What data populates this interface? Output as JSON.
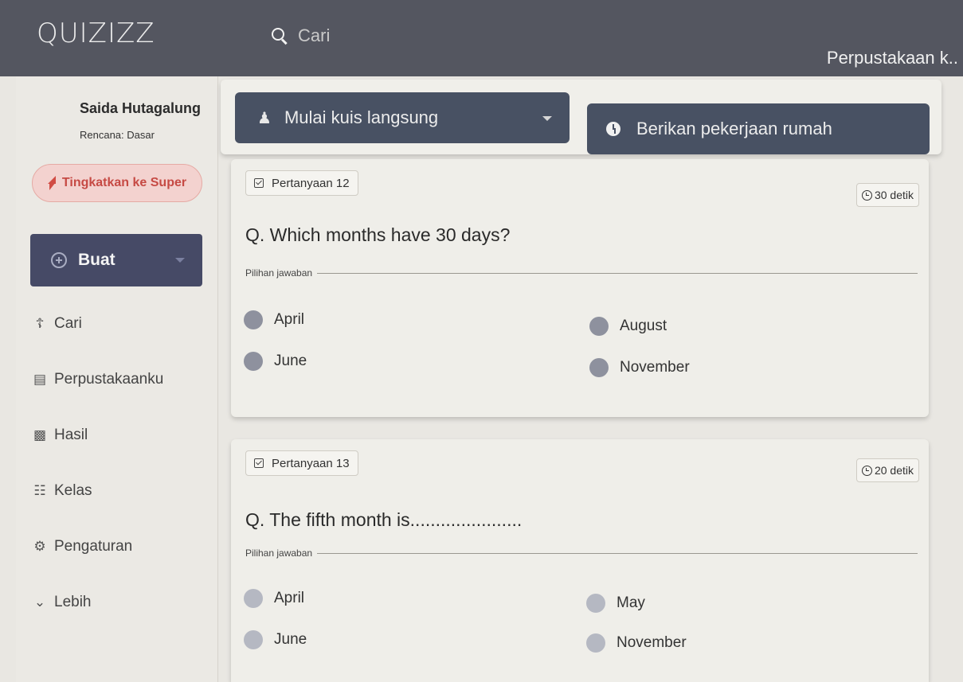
{
  "topbar": {
    "logo": "QUIZIZZ",
    "search_placeholder": "Cari",
    "library_link": "Perpustakaan k.."
  },
  "sidebar": {
    "user_name": "Saida Hutagalung",
    "plan": "Rencana: Dasar",
    "upgrade_label": "Tingkatkan ke Super",
    "create_label": "Buat",
    "items": [
      {
        "label": "Cari",
        "icon": "search-people-icon"
      },
      {
        "label": "Perpustakaanku",
        "icon": "library-icon"
      },
      {
        "label": "Hasil",
        "icon": "chart-icon"
      },
      {
        "label": "Kelas",
        "icon": "classroom-icon"
      },
      {
        "label": "Pengaturan",
        "icon": "gear-icon"
      },
      {
        "label": "Lebih",
        "icon": "chevron-down-icon"
      }
    ]
  },
  "actions": {
    "live_quiz": "Mulai kuis langsung",
    "homework": "Berikan pekerjaan rumah"
  },
  "questions": [
    {
      "label": "Pertanyaan 12",
      "time": "30 detik",
      "text": "Q. Which months have 30 days?",
      "answers_label": "Pilihan jawaban",
      "options": [
        "April",
        "August",
        "June",
        "November"
      ]
    },
    {
      "label": "Pertanyaan 13",
      "time": "20 detik",
      "text": "Q. The fifth month is......................",
      "answers_label": "Pilihan jawaban",
      "options": [
        "April",
        "May",
        "June",
        "November"
      ]
    }
  ]
}
